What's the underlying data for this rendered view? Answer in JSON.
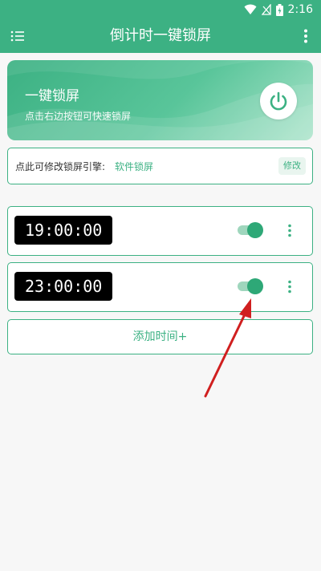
{
  "status_bar": {
    "time": "2:16",
    "icons": [
      "wifi-icon",
      "no-signal-icon",
      "battery-icon"
    ]
  },
  "app_bar": {
    "title": "倒计时一键锁屏",
    "left_icon": "menu-icon",
    "right_icon": "more-vert-icon"
  },
  "banner": {
    "title": "一键锁屏",
    "subtitle": "点击右边按钮可快速锁屏",
    "button_icon": "power-icon"
  },
  "engine": {
    "label": "点此可修改锁屏引擎:",
    "value": "软件锁屏",
    "edit_label": "修改"
  },
  "timers": [
    {
      "time": "19:00:00",
      "enabled": true
    },
    {
      "time": "23:00:00",
      "enabled": true
    }
  ],
  "add_button": {
    "label": "添加时间+"
  },
  "colors": {
    "accent": "#3cb183",
    "annotation_arrow": "#d01f1f"
  }
}
